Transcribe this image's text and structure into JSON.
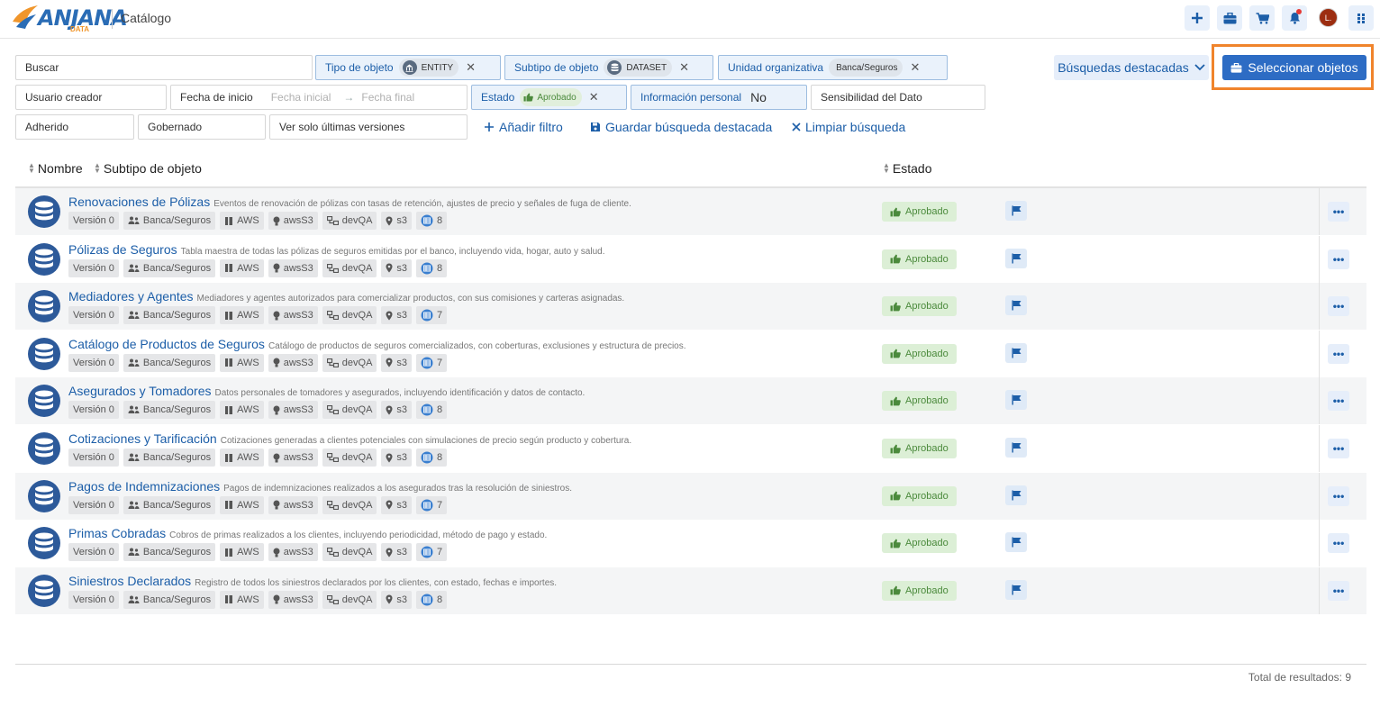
{
  "header": {
    "logo_text": "ANJANA",
    "logo_sub": "DATA",
    "title": "Catálogo",
    "avatar_initial": "L."
  },
  "filters": {
    "search_label": "Buscar",
    "tipo_objeto": {
      "label": "Tipo de objeto",
      "chip": "ENTITY"
    },
    "subtipo_objeto": {
      "label": "Subtipo de objeto",
      "chip": "DATASET"
    },
    "unidad_org": {
      "label": "Unidad organizativa",
      "chip": "Banca/Seguros"
    },
    "usuario_creador": "Usuario creador",
    "fecha_inicio": {
      "label": "Fecha de inicio",
      "from_placeholder": "Fecha inicial",
      "to_placeholder": "Fecha final"
    },
    "estado": {
      "label": "Estado",
      "chip": "Aprobado"
    },
    "info_personal": {
      "label": "Información personal",
      "value": "No"
    },
    "sensibilidad": "Sensibilidad del Dato",
    "adherido": "Adherido",
    "gobernado": "Gobernado",
    "ultimas_versiones": "Ver solo últimas versiones",
    "add_filter": "Añadir filtro",
    "save_search": "Guardar búsqueda destacada",
    "clear_search": "Limpiar búsqueda",
    "featured_searches": "Búsquedas destacadas",
    "select_objects": "Seleccionar objetos"
  },
  "table": {
    "col_name": "Nombre",
    "col_subtype": "Subtipo de objeto",
    "col_status": "Estado",
    "rows": [
      {
        "name": "Renovaciones de Pólizas",
        "desc": "Eventos de renovación de pólizas con tasas de retención, ajustes de precio y señales de fuga de cliente.",
        "count": "8"
      },
      {
        "name": "Pólizas de Seguros",
        "desc": "Tabla maestra de todas las pólizas de seguros emitidas por el banco, incluyendo vida, hogar, auto y salud.",
        "count": "8"
      },
      {
        "name": "Mediadores y Agentes",
        "desc": "Mediadores y agentes autorizados para comercializar productos, con sus comisiones y carteras asignadas.",
        "count": "7"
      },
      {
        "name": "Catálogo de Productos de Seguros",
        "desc": "Catálogo de productos de seguros comercializados, con coberturas, exclusiones y estructura de precios.",
        "count": "7"
      },
      {
        "name": "Asegurados y Tomadores",
        "desc": "Datos personales de tomadores y asegurados, incluyendo identificación y datos de contacto.",
        "count": "8"
      },
      {
        "name": "Cotizaciones y Tarificación",
        "desc": "Cotizaciones generadas a clientes potenciales con simulaciones de precio según producto y cobertura.",
        "count": "8"
      },
      {
        "name": "Pagos de Indemnizaciones",
        "desc": "Pagos de indemnizaciones realizados a los asegurados tras la resolución de siniestros.",
        "count": "7"
      },
      {
        "name": "Primas Cobradas",
        "desc": "Cobros de primas realizados a los clientes, incluyendo periodicidad, método de pago y estado.",
        "count": "7"
      },
      {
        "name": "Siniestros Declarados",
        "desc": "Registro de todos los siniestros declarados por los clientes, con estado, fechas e importes.",
        "count": "8"
      }
    ],
    "tags": {
      "version": "Versión 0",
      "org": "Banca/Seguros",
      "provider": "AWS",
      "tech": "awsS3",
      "env": "devQA",
      "location": "s3"
    },
    "status_label": "Aprobado"
  },
  "footer": {
    "total": "Total de resultados: 9"
  },
  "colors": {
    "primary": "#1c5ea8",
    "button": "#2d6cc4",
    "highlight": "#f0842c",
    "approved_bg": "#dcefd6"
  }
}
